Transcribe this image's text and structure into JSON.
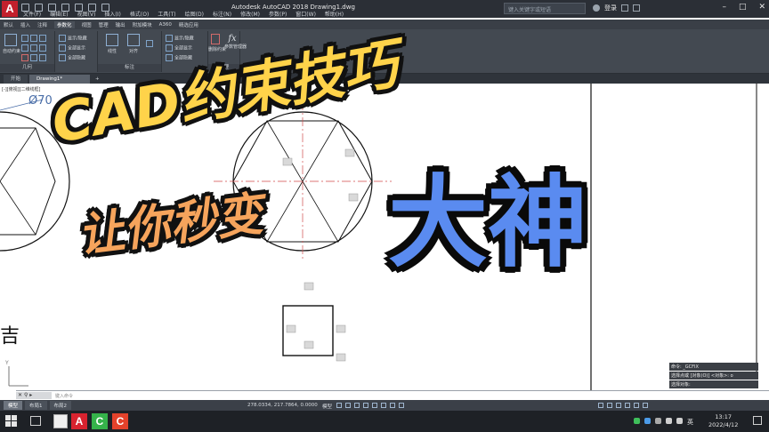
{
  "window": {
    "title": "Autodesk AutoCAD 2018    Drawing1.dwg",
    "app_letter": "A",
    "search_placeholder": "键入关键字或短语",
    "login_label": "登录"
  },
  "menu": [
    "文件(F)",
    "编辑(E)",
    "视图(V)",
    "插入(I)",
    "格式(O)",
    "工具(T)",
    "绘图(D)",
    "标注(N)",
    "修改(M)",
    "参数(P)",
    "窗口(W)",
    "帮助(H)"
  ],
  "ribbon_tabs": [
    "默认",
    "插入",
    "注释",
    "参数化",
    "视图",
    "管理",
    "输出",
    "附加模块",
    "A360",
    "精选应用"
  ],
  "ribbon_active_tab": "参数化",
  "ribbon": {
    "geometric_group": "几何",
    "auto_constrain": "自动约束",
    "show_hide": "显示/隐藏",
    "show_all": "全部显示",
    "hide_all": "全部隐藏",
    "linear": "线性",
    "aligned": "对齐",
    "dimensional_group": "标注",
    "dim_show_hide": "显示/隐藏",
    "dim_show_all": "全部显示",
    "dim_hide_all": "全部隐藏",
    "delete_constraints": "删除约束",
    "param_manager": "参数管理器",
    "manage_group": "管理",
    "fx": "fx"
  },
  "file_tabs": [
    "开始",
    "Drawing1*"
  ],
  "drawing": {
    "view_label": "[-][俯视][二维线框]",
    "dimension_text": "Ø70",
    "left_char": "吉"
  },
  "overlay": {
    "line1": "CAD约束技巧",
    "line2": "让你秒变",
    "line3": "大神"
  },
  "command_history": [
    "命令: _GCFIX",
    "选择点或 [对象(O)] <对象>: o",
    "选择对象:"
  ],
  "command_prompt": "键入命令",
  "layout_tabs": [
    "模型",
    "布局1",
    "布局2"
  ],
  "status": {
    "coords": "278.0334, 217.7864, 0.0000",
    "model": "模型"
  },
  "taskbar": {
    "ime": "英",
    "time": "13:17",
    "date": "2022/4/12"
  }
}
